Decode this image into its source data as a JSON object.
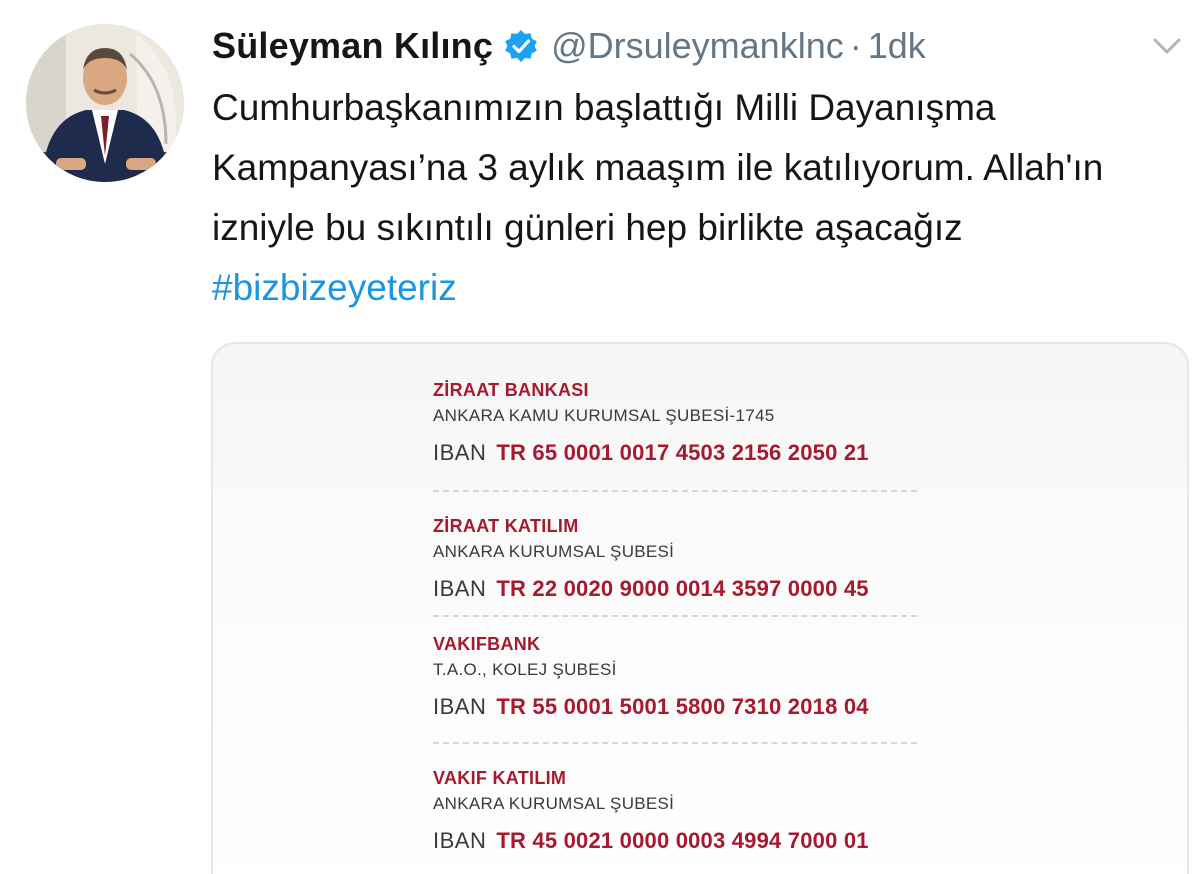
{
  "author": {
    "name": "Süleyman Kılınç",
    "handle": "@Drsuleymanklnc",
    "separator": "·",
    "time": "1dk",
    "verified": true
  },
  "tweet": {
    "text": "Cumhurbaşkanımızın başlattığı Milli Dayanışma Kampanyası’na 3 aylık maaşım ile katılıyorum. Allah'ın izniyle bu sıkıntılı günleri hep birlikte aşacağız ",
    "hashtag": "#bizbizeyeteriz"
  },
  "image": {
    "banks": [
      {
        "name": "ZİRAAT BANKASI",
        "branch": "ANKARA KAMU KURUMSAL ŞUBESİ-1745",
        "iban_label": "IBAN",
        "iban": "TR 65 0001 0017 4503 2156 2050 21"
      },
      {
        "name": "ZİRAAT KATILIM",
        "branch": "ANKARA KURUMSAL ŞUBESİ",
        "iban_label": "IBAN",
        "iban": "TR 22 0020 9000 0014 3597 0000 45"
      },
      {
        "name": "VAKIFBANK",
        "branch": "T.A.O., KOLEJ ŞUBESİ",
        "iban_label": "IBAN",
        "iban": "TR 55 0001 5001 5800 7310 2018 04"
      },
      {
        "name": "VAKIF KATILIM",
        "branch": "ANKARA KURUMSAL ŞUBESİ",
        "iban_label": "IBAN",
        "iban": "TR 45 0021 0000 0003 4994 7000 01"
      }
    ]
  },
  "colors": {
    "accent": "#1b95e0",
    "bank_red": "#a6192e",
    "muted": "#657786"
  },
  "icons": {
    "verified": "verified-badge-icon",
    "menu": "chevron-down-icon"
  }
}
